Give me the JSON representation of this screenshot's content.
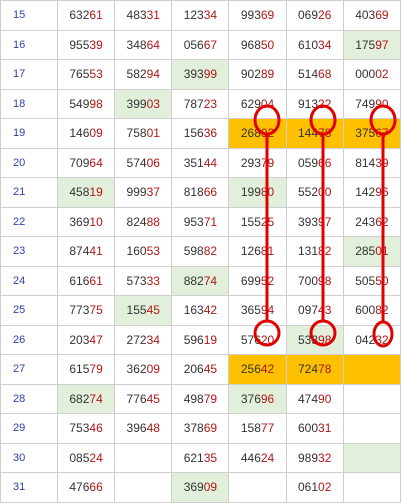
{
  "colors": {
    "grid_border": "#cfcfcf",
    "day_number": "#2c3fae",
    "digits_lead": "#333333",
    "digits_tail": "#b01717",
    "highlight_green": "#e2efda",
    "highlight_orange": "#ffc000",
    "annotation_red": "#e00000"
  },
  "rows": [
    {
      "day": "15",
      "cells": [
        {
          "lead": "632",
          "tail": "61",
          "bg": ""
        },
        {
          "lead": "483",
          "tail": "31",
          "bg": ""
        },
        {
          "lead": "123",
          "tail": "34",
          "bg": ""
        },
        {
          "lead": "993",
          "tail": "69",
          "bg": ""
        },
        {
          "lead": "069",
          "tail": "26",
          "bg": ""
        },
        {
          "lead": "403",
          "tail": "69",
          "bg": ""
        }
      ]
    },
    {
      "day": "16",
      "cells": [
        {
          "lead": "955",
          "tail": "39",
          "bg": ""
        },
        {
          "lead": "348",
          "tail": "64",
          "bg": ""
        },
        {
          "lead": "056",
          "tail": "67",
          "bg": ""
        },
        {
          "lead": "968",
          "tail": "50",
          "bg": ""
        },
        {
          "lead": "610",
          "tail": "34",
          "bg": ""
        },
        {
          "lead": "175",
          "tail": "97",
          "bg": "green"
        }
      ]
    },
    {
      "day": "17",
      "cells": [
        {
          "lead": "765",
          "tail": "53",
          "bg": ""
        },
        {
          "lead": "582",
          "tail": "94",
          "bg": ""
        },
        {
          "lead": "393",
          "tail": "99",
          "bg": "green"
        },
        {
          "lead": "902",
          "tail": "89",
          "bg": ""
        },
        {
          "lead": "514",
          "tail": "68",
          "bg": ""
        },
        {
          "lead": "000",
          "tail": "02",
          "bg": ""
        }
      ]
    },
    {
      "day": "18",
      "cells": [
        {
          "lead": "549",
          "tail": "98",
          "bg": ""
        },
        {
          "lead": "399",
          "tail": "03",
          "bg": "green"
        },
        {
          "lead": "787",
          "tail": "23",
          "bg": ""
        },
        {
          "lead": "629",
          "tail": "04",
          "bg": ""
        },
        {
          "lead": "913",
          "tail": "22",
          "bg": ""
        },
        {
          "lead": "749",
          "tail": "90",
          "bg": ""
        }
      ]
    },
    {
      "day": "19",
      "cells": [
        {
          "lead": "146",
          "tail": "09",
          "bg": ""
        },
        {
          "lead": "758",
          "tail": "01",
          "bg": ""
        },
        {
          "lead": "156",
          "tail": "36",
          "bg": ""
        },
        {
          "lead": "268",
          "tail": "92",
          "bg": "orange"
        },
        {
          "lead": "144",
          "tail": "78",
          "bg": "orange"
        },
        {
          "lead": "375",
          "tail": "67",
          "bg": "orange"
        }
      ]
    },
    {
      "day": "20",
      "cells": [
        {
          "lead": "709",
          "tail": "64",
          "bg": ""
        },
        {
          "lead": "574",
          "tail": "06",
          "bg": ""
        },
        {
          "lead": "351",
          "tail": "44",
          "bg": ""
        },
        {
          "lead": "293",
          "tail": "79",
          "bg": ""
        },
        {
          "lead": "059",
          "tail": "66",
          "bg": ""
        },
        {
          "lead": "814",
          "tail": "39",
          "bg": ""
        }
      ]
    },
    {
      "day": "21",
      "cells": [
        {
          "lead": "458",
          "tail": "19",
          "bg": "green"
        },
        {
          "lead": "999",
          "tail": "37",
          "bg": ""
        },
        {
          "lead": "818",
          "tail": "66",
          "bg": ""
        },
        {
          "lead": "199",
          "tail": "80",
          "bg": "green"
        },
        {
          "lead": "552",
          "tail": "00",
          "bg": ""
        },
        {
          "lead": "142",
          "tail": "96",
          "bg": ""
        }
      ]
    },
    {
      "day": "22",
      "cells": [
        {
          "lead": "369",
          "tail": "10",
          "bg": ""
        },
        {
          "lead": "824",
          "tail": "88",
          "bg": ""
        },
        {
          "lead": "953",
          "tail": "71",
          "bg": ""
        },
        {
          "lead": "155",
          "tail": "25",
          "bg": ""
        },
        {
          "lead": "393",
          "tail": "97",
          "bg": ""
        },
        {
          "lead": "243",
          "tail": "62",
          "bg": ""
        }
      ]
    },
    {
      "day": "23",
      "cells": [
        {
          "lead": "874",
          "tail": "41",
          "bg": ""
        },
        {
          "lead": "160",
          "tail": "53",
          "bg": ""
        },
        {
          "lead": "598",
          "tail": "82",
          "bg": ""
        },
        {
          "lead": "126",
          "tail": "81",
          "bg": ""
        },
        {
          "lead": "131",
          "tail": "82",
          "bg": ""
        },
        {
          "lead": "285",
          "tail": "01",
          "bg": "green"
        }
      ]
    },
    {
      "day": "24",
      "cells": [
        {
          "lead": "616",
          "tail": "61",
          "bg": ""
        },
        {
          "lead": "573",
          "tail": "33",
          "bg": ""
        },
        {
          "lead": "882",
          "tail": "74",
          "bg": "green"
        },
        {
          "lead": "699",
          "tail": "52",
          "bg": ""
        },
        {
          "lead": "700",
          "tail": "98",
          "bg": ""
        },
        {
          "lead": "505",
          "tail": "50",
          "bg": ""
        }
      ]
    },
    {
      "day": "25",
      "cells": [
        {
          "lead": "773",
          "tail": "75",
          "bg": ""
        },
        {
          "lead": "155",
          "tail": "45",
          "bg": "green"
        },
        {
          "lead": "163",
          "tail": "42",
          "bg": ""
        },
        {
          "lead": "365",
          "tail": "94",
          "bg": ""
        },
        {
          "lead": "097",
          "tail": "43",
          "bg": ""
        },
        {
          "lead": "600",
          "tail": "82",
          "bg": ""
        }
      ]
    },
    {
      "day": "26",
      "cells": [
        {
          "lead": "203",
          "tail": "47",
          "bg": ""
        },
        {
          "lead": "272",
          "tail": "34",
          "bg": ""
        },
        {
          "lead": "596",
          "tail": "19",
          "bg": ""
        },
        {
          "lead": "576",
          "tail": "20",
          "bg": ""
        },
        {
          "lead": "533",
          "tail": "98",
          "bg": "green"
        },
        {
          "lead": "042",
          "tail": "32",
          "bg": ""
        }
      ]
    },
    {
      "day": "27",
      "cells": [
        {
          "lead": "615",
          "tail": "79",
          "bg": ""
        },
        {
          "lead": "362",
          "tail": "09",
          "bg": ""
        },
        {
          "lead": "206",
          "tail": "45",
          "bg": ""
        },
        {
          "lead": "256",
          "tail": "42",
          "bg": "orange"
        },
        {
          "lead": "724",
          "tail": "78",
          "bg": "orange"
        },
        {
          "lead": "",
          "tail": "",
          "bg": "orange"
        }
      ]
    },
    {
      "day": "28",
      "cells": [
        {
          "lead": "682",
          "tail": "74",
          "bg": "green"
        },
        {
          "lead": "776",
          "tail": "45",
          "bg": ""
        },
        {
          "lead": "498",
          "tail": "79",
          "bg": ""
        },
        {
          "lead": "376",
          "tail": "96",
          "bg": "green"
        },
        {
          "lead": "474",
          "tail": "90",
          "bg": ""
        },
        {
          "lead": "",
          "tail": "",
          "bg": ""
        }
      ]
    },
    {
      "day": "29",
      "cells": [
        {
          "lead": "753",
          "tail": "46",
          "bg": ""
        },
        {
          "lead": "396",
          "tail": "48",
          "bg": ""
        },
        {
          "lead": "378",
          "tail": "69",
          "bg": ""
        },
        {
          "lead": "158",
          "tail": "77",
          "bg": ""
        },
        {
          "lead": "600",
          "tail": "31",
          "bg": ""
        },
        {
          "lead": "",
          "tail": "",
          "bg": ""
        }
      ]
    },
    {
      "day": "30",
      "cells": [
        {
          "lead": "085",
          "tail": "24",
          "bg": ""
        },
        {
          "lead": "",
          "tail": "",
          "bg": ""
        },
        {
          "lead": "621",
          "tail": "35",
          "bg": ""
        },
        {
          "lead": "446",
          "tail": "24",
          "bg": ""
        },
        {
          "lead": "989",
          "tail": "32",
          "bg": ""
        },
        {
          "lead": "",
          "tail": "",
          "bg": "green"
        }
      ]
    },
    {
      "day": "31",
      "cells": [
        {
          "lead": "476",
          "tail": "66",
          "bg": ""
        },
        {
          "lead": "",
          "tail": "",
          "bg": ""
        },
        {
          "lead": "369",
          "tail": "09",
          "bg": "green"
        },
        {
          "lead": "",
          "tail": "",
          "bg": ""
        },
        {
          "lead": "061",
          "tail": "02",
          "bg": ""
        },
        {
          "lead": "",
          "tail": "",
          "bg": ""
        }
      ]
    }
  ]
}
